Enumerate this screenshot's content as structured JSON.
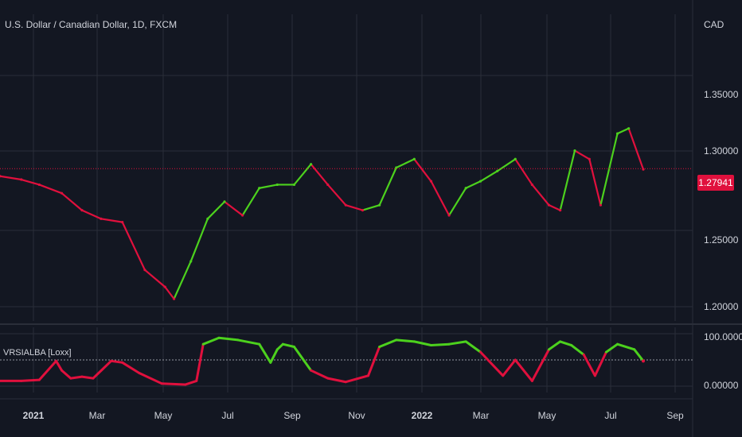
{
  "header": {
    "symbol_title": "U.S. Dollar / Canadian Dollar, 1D, FXCM",
    "currency": "CAD"
  },
  "price_axis": {
    "labels": [
      "1.35000",
      "1.30000",
      "1.25000",
      "1.20000"
    ],
    "last_price": "1.27941"
  },
  "indicator": {
    "name": "VRSIALBA [Loxx]",
    "axis_labels": [
      "100.00000",
      "0.00000"
    ]
  },
  "time_axis": {
    "labels": [
      {
        "text": "2021",
        "bold": true
      },
      {
        "text": "Mar",
        "bold": false
      },
      {
        "text": "May",
        "bold": false
      },
      {
        "text": "Jul",
        "bold": false
      },
      {
        "text": "Sep",
        "bold": false
      },
      {
        "text": "Nov",
        "bold": false
      },
      {
        "text": "2022",
        "bold": true
      },
      {
        "text": "Mar",
        "bold": false
      },
      {
        "text": "May",
        "bold": false
      },
      {
        "text": "Jul",
        "bold": false
      },
      {
        "text": "Sep",
        "bold": false
      }
    ]
  },
  "colors": {
    "bull": "#4cd11d",
    "bear": "#e0103d",
    "background": "#131722",
    "grid": "#2a2e39"
  },
  "chart_data": [
    {
      "type": "line",
      "title": "U.S. Dollar / Canadian Dollar, 1D, FXCM",
      "y_unit": "CAD",
      "ylim": [
        1.19,
        1.37
      ],
      "x": [
        "2021-01-01",
        "2021-01-20",
        "2021-02-05",
        "2021-02-25",
        "2021-03-15",
        "2021-04-01",
        "2021-04-20",
        "2021-05-10",
        "2021-05-28",
        "2021-06-05",
        "2021-06-20",
        "2021-07-05",
        "2021-07-20",
        "2021-08-05",
        "2021-08-20",
        "2021-09-05",
        "2021-09-20",
        "2021-10-05",
        "2021-10-20",
        "2021-11-05",
        "2021-11-20",
        "2021-12-05",
        "2021-12-20",
        "2022-01-05",
        "2022-01-20",
        "2022-02-05",
        "2022-02-20",
        "2022-03-05",
        "2022-03-20",
        "2022-04-05",
        "2022-04-20",
        "2022-05-05",
        "2022-05-15",
        "2022-05-28",
        "2022-06-10",
        "2022-06-20",
        "2022-07-05",
        "2022-07-15",
        "2022-07-28"
      ],
      "y": [
        1.275,
        1.273,
        1.27,
        1.265,
        1.255,
        1.25,
        1.248,
        1.22,
        1.21,
        1.203,
        1.225,
        1.25,
        1.26,
        1.252,
        1.268,
        1.27,
        1.27,
        1.282,
        1.27,
        1.258,
        1.255,
        1.258,
        1.28,
        1.285,
        1.272,
        1.252,
        1.268,
        1.272,
        1.278,
        1.285,
        1.27,
        1.258,
        1.255,
        1.29,
        1.285,
        1.258,
        1.3,
        1.303,
        1.279
      ],
      "grid": true,
      "last_value": 1.27941
    },
    {
      "type": "line",
      "title": "VRSIALBA [Loxx]",
      "ylim": [
        0,
        100
      ],
      "x": [
        "2021-01-01",
        "2021-01-20",
        "2021-02-05",
        "2021-02-20",
        "2021-02-25",
        "2021-03-05",
        "2021-03-15",
        "2021-03-25",
        "2021-04-10",
        "2021-04-20",
        "2021-05-05",
        "2021-05-25",
        "2021-06-15",
        "2021-06-25",
        "2021-07-01",
        "2021-07-15",
        "2021-08-01",
        "2021-08-20",
        "2021-08-30",
        "2021-09-05",
        "2021-09-10",
        "2021-09-20",
        "2021-10-05",
        "2021-10-20",
        "2021-11-05",
        "2021-11-25",
        "2021-12-05",
        "2021-12-20",
        "2022-01-05",
        "2022-01-20",
        "2022-02-05",
        "2022-02-20",
        "2022-03-05",
        "2022-03-25",
        "2022-04-05",
        "2022-04-20",
        "2022-05-05",
        "2022-05-15",
        "2022-05-25",
        "2022-06-05",
        "2022-06-15",
        "2022-06-25",
        "2022-07-05",
        "2022-07-20",
        "2022-07-28"
      ],
      "y": [
        10,
        10,
        12,
        48,
        30,
        15,
        18,
        15,
        48,
        45,
        25,
        5,
        3,
        10,
        80,
        92,
        88,
        80,
        45,
        70,
        80,
        75,
        30,
        15,
        8,
        20,
        75,
        88,
        85,
        78,
        80,
        85,
        65,
        20,
        50,
        10,
        70,
        85,
        78,
        60,
        20,
        65,
        80,
        70,
        48
      ],
      "threshold": 50,
      "grid": true
    }
  ]
}
